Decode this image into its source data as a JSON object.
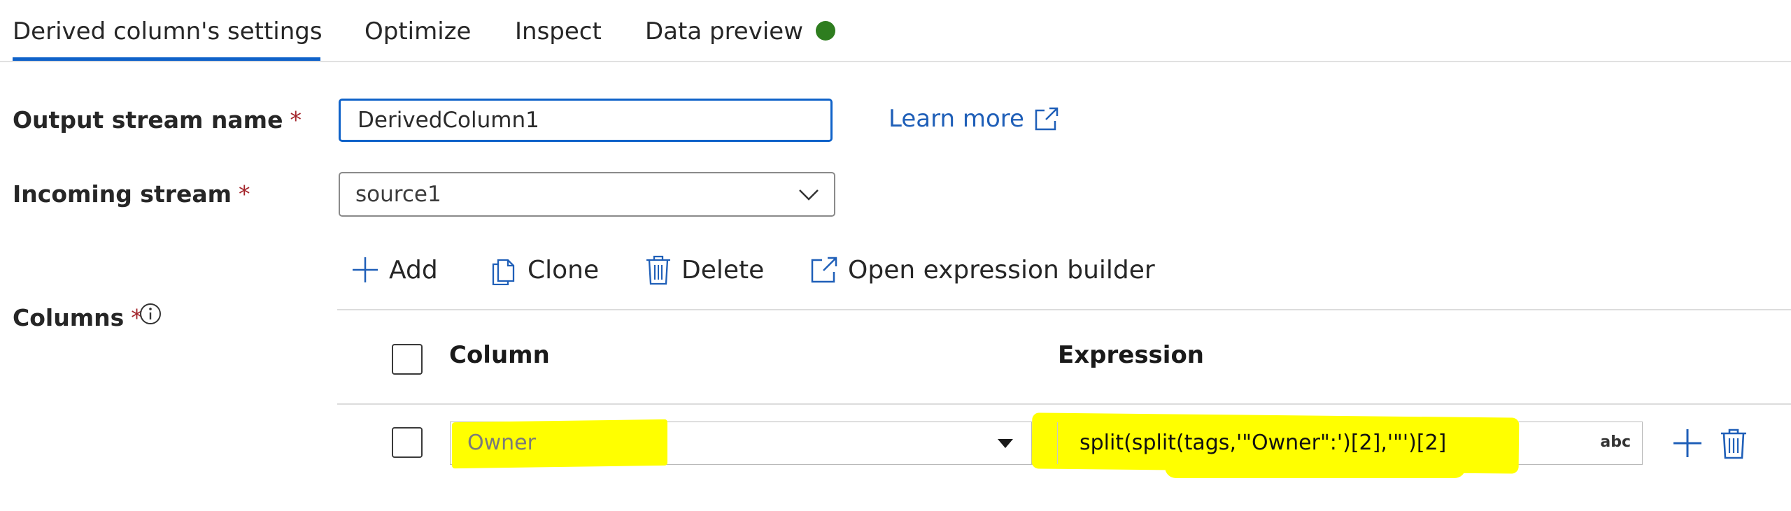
{
  "tabs": [
    {
      "label": "Derived column's settings",
      "active": true
    },
    {
      "label": "Optimize",
      "active": false
    },
    {
      "label": "Inspect",
      "active": false
    },
    {
      "label": "Data preview",
      "active": false
    }
  ],
  "status": {
    "data_preview_dot_color": "#2e7d1f"
  },
  "form": {
    "output_stream": {
      "label": "Output stream name",
      "required_mark": "*",
      "value": "DerivedColumn1"
    },
    "incoming_stream": {
      "label": "Incoming stream",
      "required_mark": "*",
      "value": "source1"
    },
    "columns": {
      "label": "Columns",
      "required_mark": "*",
      "info_icon": "info-icon"
    }
  },
  "learn_more": {
    "label": "Learn more",
    "icon": "external-link-icon"
  },
  "toolbar": {
    "add_label": "Add",
    "clone_label": "Clone",
    "delete_label": "Delete",
    "open_builder_label": "Open expression builder"
  },
  "table": {
    "headers": {
      "column": "Column",
      "expression": "Expression"
    },
    "rows": [
      {
        "column": "Owner",
        "expression": "split(split(tags,'\"Owner\":')[2],'\"')[2]",
        "type_badge": "abc"
      }
    ]
  },
  "colors": {
    "accent": "#0f62c9",
    "required": "#a4262c",
    "highlight": "#ffff00",
    "link": "#1f5fb8"
  }
}
